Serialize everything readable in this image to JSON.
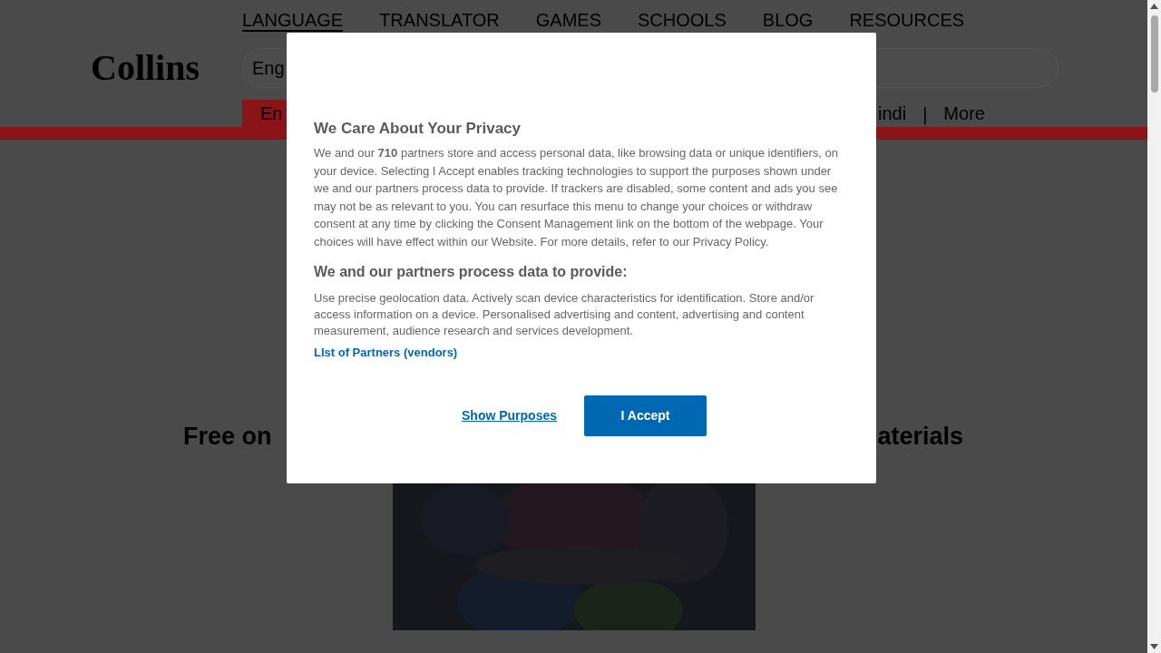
{
  "nav": [
    {
      "label": "LANGUAGE",
      "selected": true
    },
    {
      "label": "TRANSLATOR",
      "selected": false
    },
    {
      "label": "GAMES",
      "selected": false
    },
    {
      "label": "SCHOOLS",
      "selected": false
    },
    {
      "label": "BLOG",
      "selected": false
    },
    {
      "label": "RESOURCES",
      "selected": false
    }
  ],
  "logo": "Collins",
  "search": {
    "placeholder": "Eng"
  },
  "language_tabs": [
    {
      "kind": "tab",
      "label": "En",
      "selected": true
    },
    {
      "kind": "tab",
      "label": "indi",
      "selected": false
    },
    {
      "kind": "separator",
      "label": "|"
    },
    {
      "kind": "tab",
      "label": "More",
      "selected": false
    }
  ],
  "headline": {
    "left": "Free on",
    "right": "aterials"
  },
  "consent": {
    "title": "We Care About Your Privacy",
    "body": "We and our **710** partners store and access personal data, like browsing data or unique identifiers, on your device. Selecting I Accept enables tracking technologies to support the purposes shown under we and our partners process data to provide. If trackers are disabled, some content and ads you see may not be as relevant to you. You can resurface this menu to change your choices or withdraw consent at any time by clicking the Consent Management link on the bottom of the webpage. Your choices will have effect within our Website. For more details, refer to our Privacy Policy.",
    "purposes_heading": "We and our partners process data to provide:",
    "purposes": "Use precise geolocation data. Actively scan device characteristics for identification. Store and/or access information on a device. Personalised advertising and content, advertising and content measurement, audience research and services development.",
    "partners_link": "LIst of Partners (vendors)",
    "show_purposes": "Show Purposes",
    "accept": "I Accept"
  }
}
